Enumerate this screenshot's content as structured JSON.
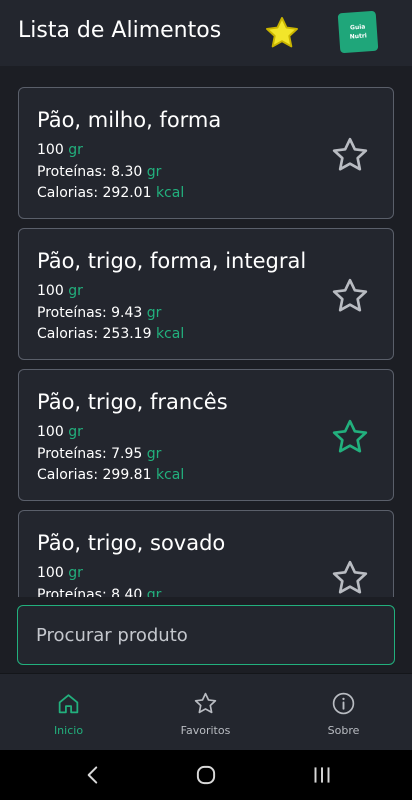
{
  "header": {
    "title": "Lista de Alimentos",
    "logo_line1": "Guia",
    "logo_line2": "Nutri"
  },
  "foods": [
    {
      "name": "Pão, milho, forma",
      "amount": "100",
      "amount_unit": "gr",
      "protein_label": "Proteínas:",
      "protein": "8.30",
      "protein_unit": "gr",
      "calories_label": "Calorias:",
      "calories": "292.01",
      "calories_unit": "kcal",
      "favorite": false
    },
    {
      "name": "Pão, trigo, forma, integral",
      "amount": "100",
      "amount_unit": "gr",
      "protein_label": "Proteínas:",
      "protein": "9.43",
      "protein_unit": "gr",
      "calories_label": "Calorias:",
      "calories": "253.19",
      "calories_unit": "kcal",
      "favorite": false
    },
    {
      "name": "Pão, trigo, francês",
      "amount": "100",
      "amount_unit": "gr",
      "protein_label": "Proteínas:",
      "protein": "7.95",
      "protein_unit": "gr",
      "calories_label": "Calorias:",
      "calories": "299.81",
      "calories_unit": "kcal",
      "favorite": true
    },
    {
      "name": "Pão, trigo, sovado",
      "amount": "100",
      "amount_unit": "gr",
      "protein_label": "Proteínas:",
      "protein": "8.40",
      "protein_unit": "gr",
      "calories_label": "",
      "calories": "",
      "calories_unit": "",
      "favorite": false
    }
  ],
  "search": {
    "placeholder": "Procurar produto",
    "value": ""
  },
  "nav": [
    {
      "label": "Inicio",
      "icon": "home-icon",
      "active": true
    },
    {
      "label": "Favoritos",
      "icon": "star-icon",
      "active": false
    },
    {
      "label": "Sobre",
      "icon": "info-icon",
      "active": false
    }
  ],
  "system_nav": {
    "back": "back-icon",
    "home": "home-circle-icon",
    "recents": "recents-icon"
  },
  "colors": {
    "accent": "#22b07d",
    "favorite_header": "#f2e52a",
    "background": "#1c1e24",
    "surface": "#23262e",
    "border": "#5a5f6a"
  }
}
